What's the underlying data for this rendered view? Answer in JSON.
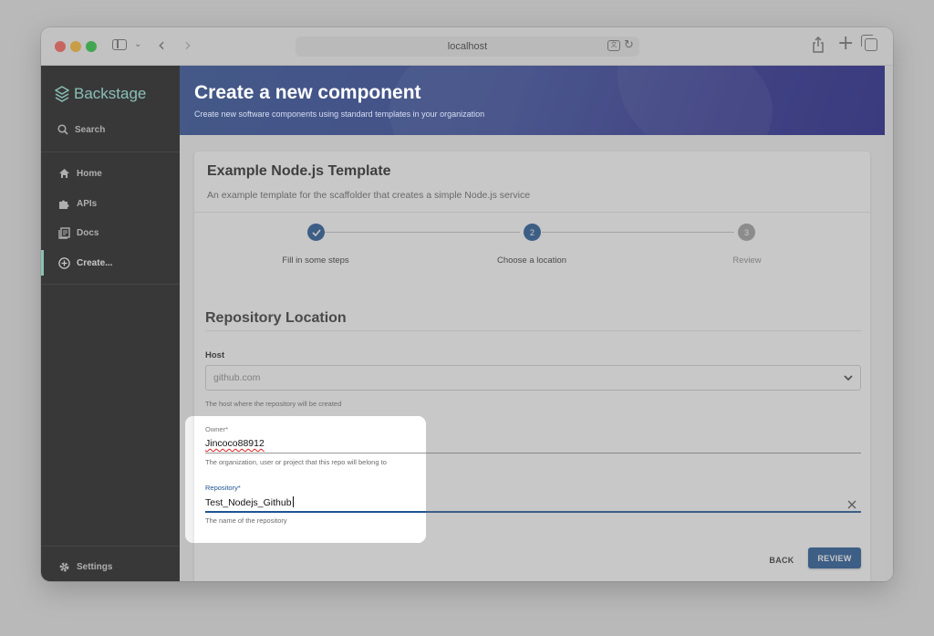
{
  "browser": {
    "url": "localhost"
  },
  "sidebar": {
    "brand": "Backstage",
    "search_label": "Search",
    "items": [
      {
        "label": "Home",
        "icon": "home-icon"
      },
      {
        "label": "APIs",
        "icon": "puzzle-icon"
      },
      {
        "label": "Docs",
        "icon": "docs-icon"
      },
      {
        "label": "Create...",
        "icon": "add-circle-icon",
        "active": true
      }
    ],
    "settings_label": "Settings",
    "accent_color": "#9bf0e1"
  },
  "header": {
    "title": "Create a new component",
    "subtitle": "Create new software components using standard templates in your organization"
  },
  "template": {
    "title": "Example Node.js Template",
    "description": "An example template for the scaffolder that creates a simple Node.js service"
  },
  "stepper": {
    "steps": [
      {
        "label": "Fill in some steps",
        "number": "1",
        "state": "completed"
      },
      {
        "label": "Choose a location",
        "number": "2",
        "state": "active"
      },
      {
        "label": "Review",
        "number": "3",
        "state": "pending"
      }
    ],
    "primary_color": "#1f5493"
  },
  "form": {
    "section_title": "Repository Location",
    "host": {
      "label": "Host",
      "value": "github.com",
      "helper": "The host where the repository will be created"
    },
    "owner": {
      "label": "Owner*",
      "value": "Jincoco88912",
      "helper": "The organization, user or project that this repo will belong to"
    },
    "repository": {
      "label": "Repository*",
      "value": "Test_Nodejs_Github",
      "helper": "The name of the repository"
    },
    "back_label": "BACK",
    "review_label": "REVIEW"
  }
}
